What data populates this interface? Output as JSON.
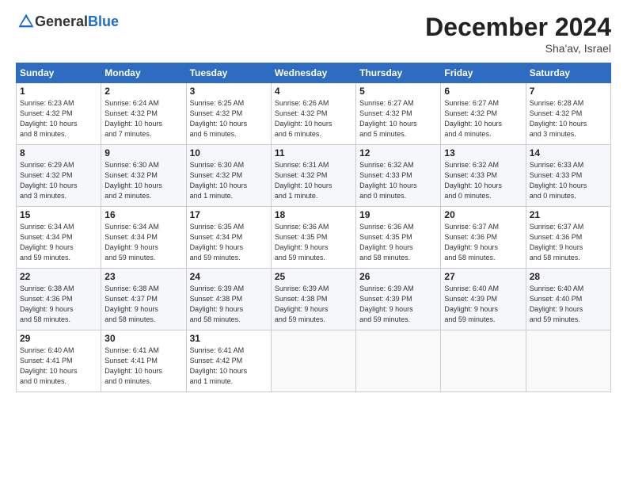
{
  "header": {
    "logo_general": "General",
    "logo_blue": "Blue",
    "month_title": "December 2024",
    "location": "Sha'av, Israel"
  },
  "days_of_week": [
    "Sunday",
    "Monday",
    "Tuesday",
    "Wednesday",
    "Thursday",
    "Friday",
    "Saturday"
  ],
  "weeks": [
    [
      {
        "day": "1",
        "info": "Sunrise: 6:23 AM\nSunset: 4:32 PM\nDaylight: 10 hours\nand 8 minutes."
      },
      {
        "day": "2",
        "info": "Sunrise: 6:24 AM\nSunset: 4:32 PM\nDaylight: 10 hours\nand 7 minutes."
      },
      {
        "day": "3",
        "info": "Sunrise: 6:25 AM\nSunset: 4:32 PM\nDaylight: 10 hours\nand 6 minutes."
      },
      {
        "day": "4",
        "info": "Sunrise: 6:26 AM\nSunset: 4:32 PM\nDaylight: 10 hours\nand 6 minutes."
      },
      {
        "day": "5",
        "info": "Sunrise: 6:27 AM\nSunset: 4:32 PM\nDaylight: 10 hours\nand 5 minutes."
      },
      {
        "day": "6",
        "info": "Sunrise: 6:27 AM\nSunset: 4:32 PM\nDaylight: 10 hours\nand 4 minutes."
      },
      {
        "day": "7",
        "info": "Sunrise: 6:28 AM\nSunset: 4:32 PM\nDaylight: 10 hours\nand 3 minutes."
      }
    ],
    [
      {
        "day": "8",
        "info": "Sunrise: 6:29 AM\nSunset: 4:32 PM\nDaylight: 10 hours\nand 3 minutes."
      },
      {
        "day": "9",
        "info": "Sunrise: 6:30 AM\nSunset: 4:32 PM\nDaylight: 10 hours\nand 2 minutes."
      },
      {
        "day": "10",
        "info": "Sunrise: 6:30 AM\nSunset: 4:32 PM\nDaylight: 10 hours\nand 1 minute."
      },
      {
        "day": "11",
        "info": "Sunrise: 6:31 AM\nSunset: 4:32 PM\nDaylight: 10 hours\nand 1 minute."
      },
      {
        "day": "12",
        "info": "Sunrise: 6:32 AM\nSunset: 4:33 PM\nDaylight: 10 hours\nand 0 minutes."
      },
      {
        "day": "13",
        "info": "Sunrise: 6:32 AM\nSunset: 4:33 PM\nDaylight: 10 hours\nand 0 minutes."
      },
      {
        "day": "14",
        "info": "Sunrise: 6:33 AM\nSunset: 4:33 PM\nDaylight: 10 hours\nand 0 minutes."
      }
    ],
    [
      {
        "day": "15",
        "info": "Sunrise: 6:34 AM\nSunset: 4:34 PM\nDaylight: 9 hours\nand 59 minutes."
      },
      {
        "day": "16",
        "info": "Sunrise: 6:34 AM\nSunset: 4:34 PM\nDaylight: 9 hours\nand 59 minutes."
      },
      {
        "day": "17",
        "info": "Sunrise: 6:35 AM\nSunset: 4:34 PM\nDaylight: 9 hours\nand 59 minutes."
      },
      {
        "day": "18",
        "info": "Sunrise: 6:36 AM\nSunset: 4:35 PM\nDaylight: 9 hours\nand 59 minutes."
      },
      {
        "day": "19",
        "info": "Sunrise: 6:36 AM\nSunset: 4:35 PM\nDaylight: 9 hours\nand 58 minutes."
      },
      {
        "day": "20",
        "info": "Sunrise: 6:37 AM\nSunset: 4:36 PM\nDaylight: 9 hours\nand 58 minutes."
      },
      {
        "day": "21",
        "info": "Sunrise: 6:37 AM\nSunset: 4:36 PM\nDaylight: 9 hours\nand 58 minutes."
      }
    ],
    [
      {
        "day": "22",
        "info": "Sunrise: 6:38 AM\nSunset: 4:36 PM\nDaylight: 9 hours\nand 58 minutes."
      },
      {
        "day": "23",
        "info": "Sunrise: 6:38 AM\nSunset: 4:37 PM\nDaylight: 9 hours\nand 58 minutes."
      },
      {
        "day": "24",
        "info": "Sunrise: 6:39 AM\nSunset: 4:38 PM\nDaylight: 9 hours\nand 58 minutes."
      },
      {
        "day": "25",
        "info": "Sunrise: 6:39 AM\nSunset: 4:38 PM\nDaylight: 9 hours\nand 59 minutes."
      },
      {
        "day": "26",
        "info": "Sunrise: 6:39 AM\nSunset: 4:39 PM\nDaylight: 9 hours\nand 59 minutes."
      },
      {
        "day": "27",
        "info": "Sunrise: 6:40 AM\nSunset: 4:39 PM\nDaylight: 9 hours\nand 59 minutes."
      },
      {
        "day": "28",
        "info": "Sunrise: 6:40 AM\nSunset: 4:40 PM\nDaylight: 9 hours\nand 59 minutes."
      }
    ],
    [
      {
        "day": "29",
        "info": "Sunrise: 6:40 AM\nSunset: 4:41 PM\nDaylight: 10 hours\nand 0 minutes."
      },
      {
        "day": "30",
        "info": "Sunrise: 6:41 AM\nSunset: 4:41 PM\nDaylight: 10 hours\nand 0 minutes."
      },
      {
        "day": "31",
        "info": "Sunrise: 6:41 AM\nSunset: 4:42 PM\nDaylight: 10 hours\nand 1 minute."
      },
      {
        "day": "",
        "info": ""
      },
      {
        "day": "",
        "info": ""
      },
      {
        "day": "",
        "info": ""
      },
      {
        "day": "",
        "info": ""
      }
    ]
  ]
}
